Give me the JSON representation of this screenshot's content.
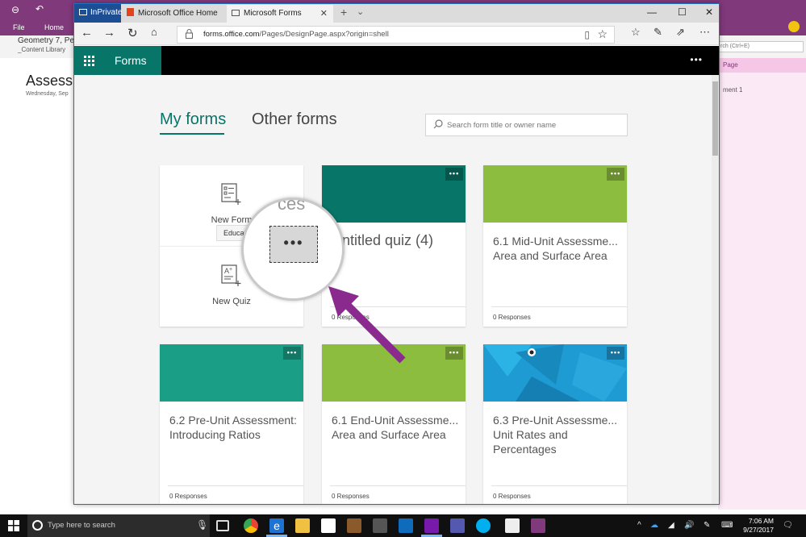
{
  "onenote": {
    "file_label": "File",
    "home_label": "Home",
    "notebook_name": "Geometry 7, Per",
    "section_name": "_Content Library",
    "page_title": "Assessm",
    "page_date": "Wednesday, Sep",
    "search_placeholder": "rch (Ctrl+E)",
    "add_page_label": "Page",
    "assessment_label": "ment 1",
    "accent_color": "#80397b"
  },
  "browser": {
    "tabs": [
      {
        "label": "InPrivate",
        "icon": "inprivate-icon"
      },
      {
        "label": "Microsoft Office Home",
        "icon": "office-icon"
      },
      {
        "label": "Microsoft Forms",
        "icon": "page-icon"
      }
    ],
    "url_host": "forms.office.com",
    "url_path": "/Pages/DesignPage.aspx?origin=shell"
  },
  "forms": {
    "brand": "Forms",
    "brand_color": "#077568",
    "tab_my_forms": "My forms",
    "tab_other_forms": "Other forms",
    "search_placeholder": "Search form title or owner name",
    "new_form_label": "New Form",
    "new_quiz_label": "New Quiz",
    "tooltip_text": "Educati",
    "magnifier_text": "ces",
    "more_label": "•••",
    "cards": [
      {
        "title": "Untitled quiz (4)",
        "responses": "0 Responses",
        "banner_color": "#077568"
      },
      {
        "title": "6.1 Mid-Unit Assessme... Area and Surface Area",
        "responses": "0 Responses",
        "banner_color": "#8cbd3f"
      },
      {
        "title": "6.2 Pre-Unit Assessment: Introducing Ratios",
        "responses": "0 Responses",
        "banner_color": "#1b9e86"
      },
      {
        "title": "6.1 End-Unit Assessme... Area and Surface Area",
        "responses": "0 Responses",
        "banner_color": "#8cbd3f"
      },
      {
        "title": "6.3 Pre-Unit Assessme... Unit Rates and Percentages",
        "responses": "0 Responses",
        "banner_color": "#1e9bd3"
      }
    ]
  },
  "taskbar": {
    "search_placeholder": "Type here to search",
    "time": "7:06 AM",
    "date": "9/27/2017"
  }
}
